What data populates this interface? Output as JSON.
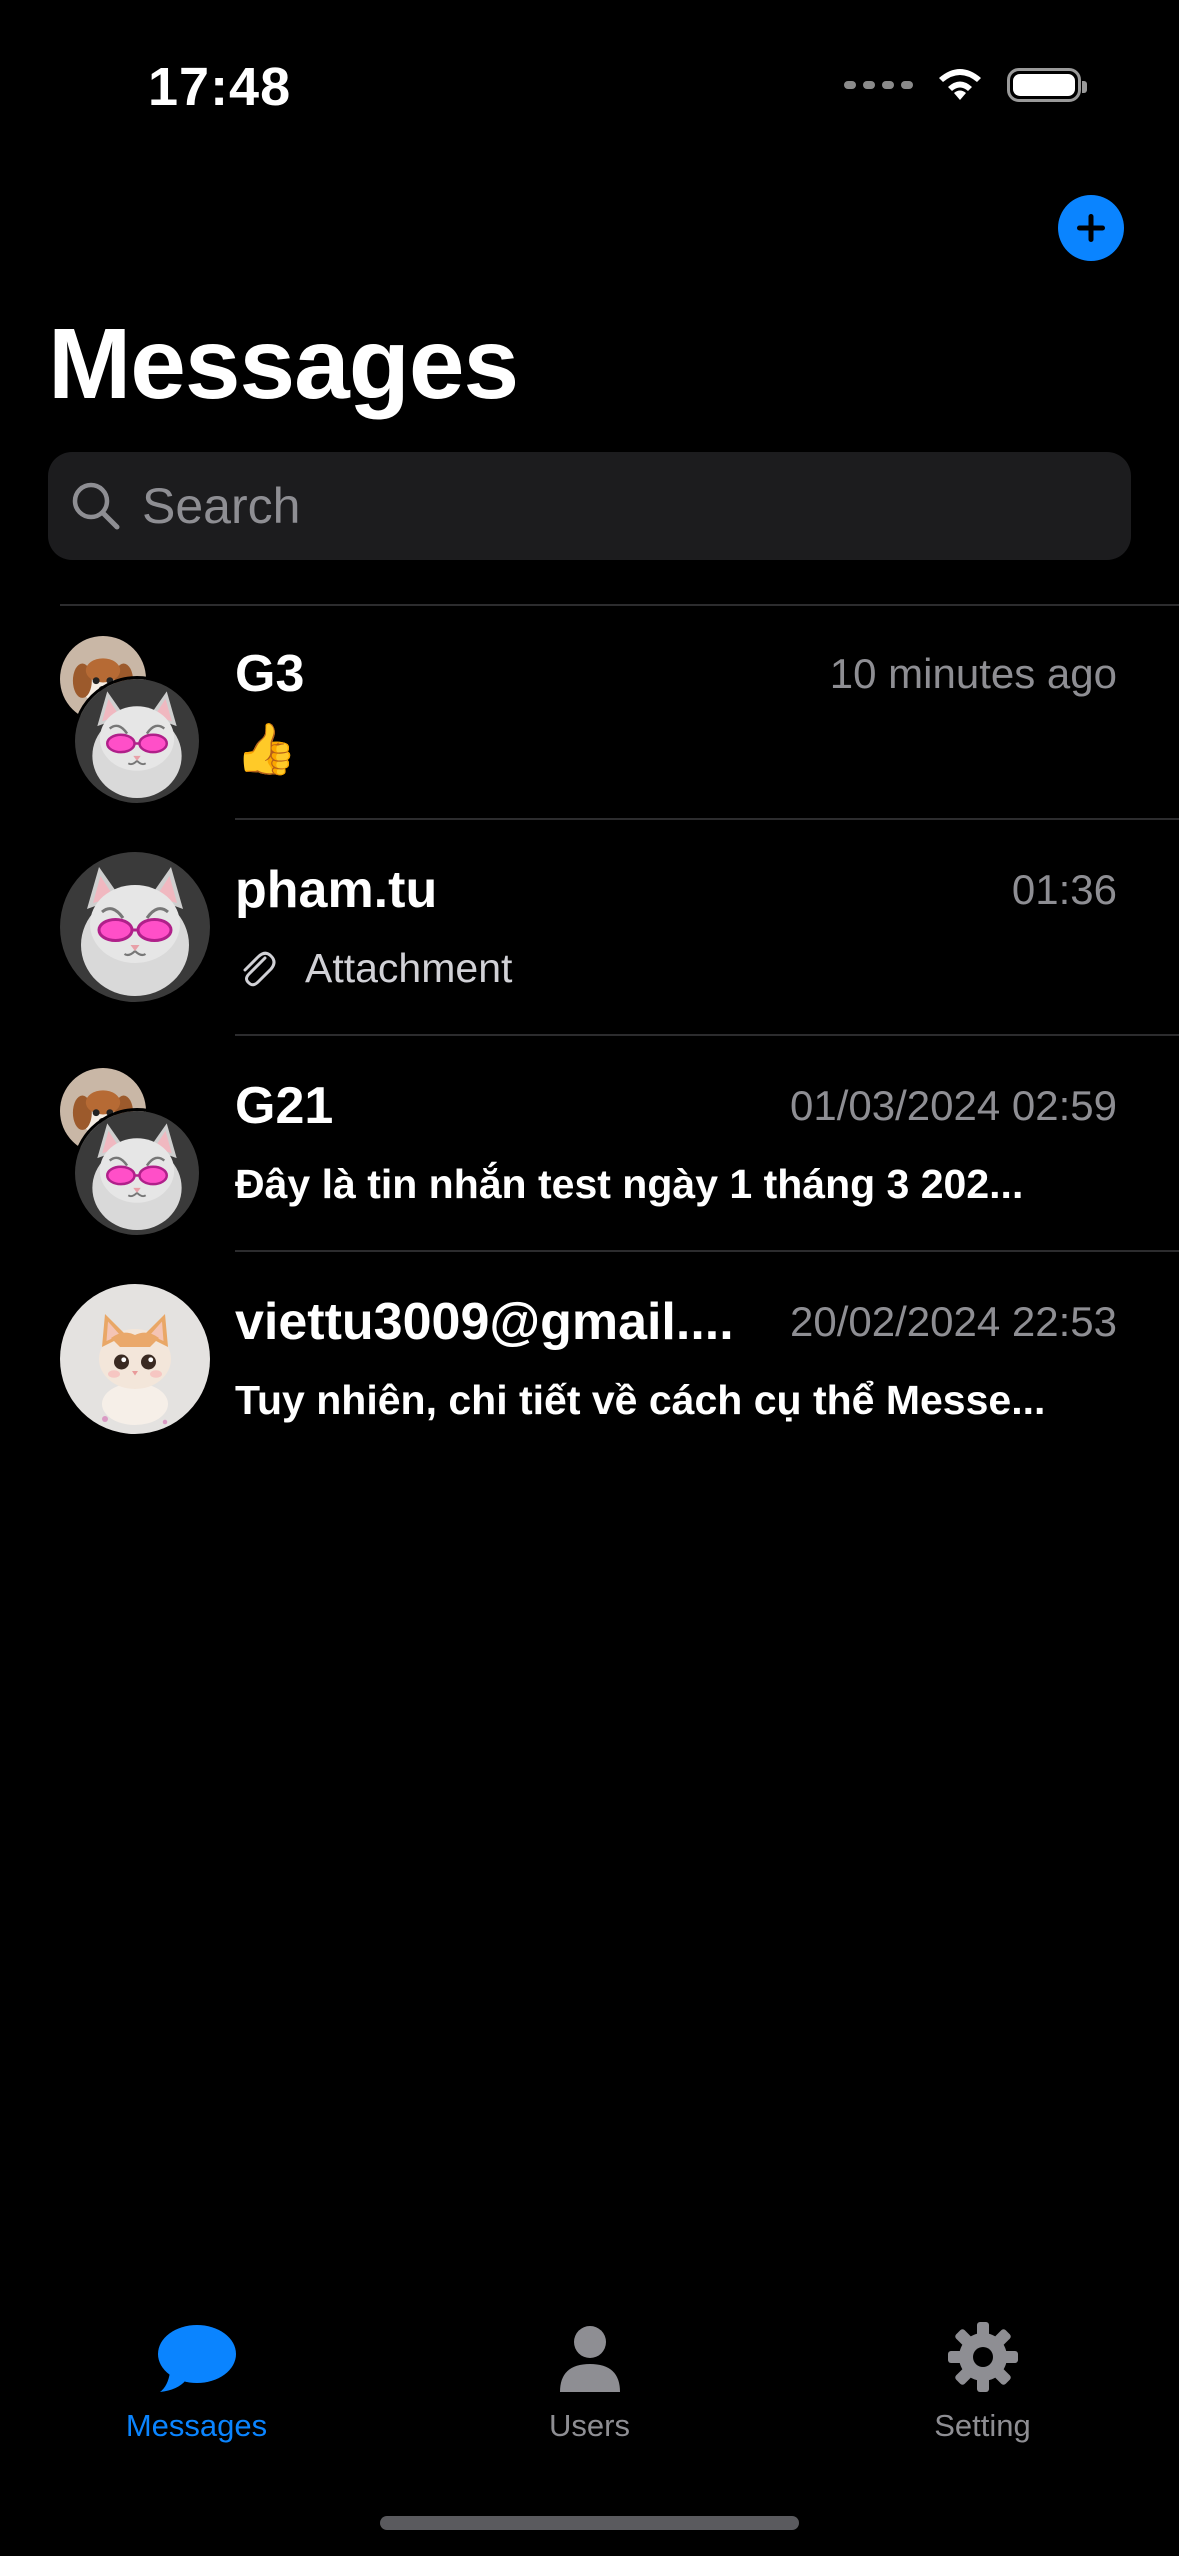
{
  "status_bar": {
    "time": "17:48"
  },
  "header": {
    "title": "Messages",
    "add_icon": "plus-icon"
  },
  "search": {
    "placeholder": "Search",
    "value": ""
  },
  "chats": [
    {
      "name": "G3",
      "time": "10 minutes ago",
      "preview": "👍",
      "avatar": "group-cat-dog"
    },
    {
      "name": "pham.tu",
      "time": "01:36",
      "preview": "Attachment",
      "avatar": "cat-glasses"
    },
    {
      "name": "G21",
      "time": "01/03/2024 02:59",
      "preview": "Đây là tin nhắn test ngày 1 tháng 3 202...",
      "avatar": "group-cat-dog"
    },
    {
      "name": "viettu3009@gmail....",
      "time": "20/02/2024 22:53",
      "preview": "Tuy nhiên, chi tiết về cách cụ thể Messe...",
      "avatar": "kitten"
    }
  ],
  "tabs": [
    {
      "label": "Messages",
      "icon": "chat-bubble-icon",
      "active": true
    },
    {
      "label": "Users",
      "icon": "user-icon",
      "active": false
    },
    {
      "label": "Setting",
      "icon": "gear-icon",
      "active": false
    }
  ],
  "colors": {
    "accent": "#0a84ff",
    "background": "#000000",
    "secondary_text": "#8e8e93"
  }
}
